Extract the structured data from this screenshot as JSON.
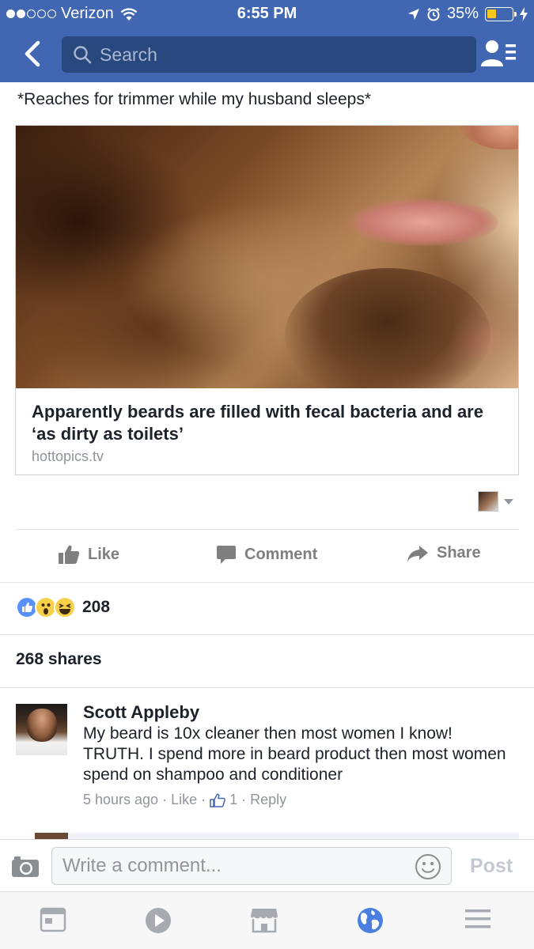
{
  "status_bar": {
    "carrier": "Verizon",
    "time": "6:55 PM",
    "battery": "35%",
    "battery_level": 0.35
  },
  "nav": {
    "search_placeholder": "Search",
    "back_icon": "chevron-left-icon",
    "friends_icon": "friend-requests-icon"
  },
  "post": {
    "caption": "*Reaches for trimmer while my husband sleeps*",
    "link": {
      "title": "Apparently beards are filled with fecal bacteria and are ‘as dirty as toilets’",
      "domain": "hottopics.tv"
    },
    "actions": {
      "like": "Like",
      "comment": "Comment",
      "share": "Share"
    },
    "reactions": {
      "types": [
        "like",
        "wow",
        "haha"
      ],
      "count": "208"
    },
    "shares": "268 shares"
  },
  "comment": {
    "author": "Scott Appleby",
    "text": "My beard is 10x cleaner then most women I know! TRUTH. I spend more in beard product then most women spend on shampoo and conditioner",
    "time": "5 hours ago",
    "like_label": "Like",
    "like_count": "1",
    "reply_label": "Reply"
  },
  "composer": {
    "placeholder": "Write a comment...",
    "post_label": "Post"
  },
  "tabbar": {
    "tabs": [
      "news-feed-icon",
      "video-icon",
      "marketplace-icon",
      "globe-icon",
      "menu-icon"
    ],
    "active": "globe-icon"
  },
  "colors": {
    "brand": "#4267b2",
    "search_bg": "#29487d",
    "action_gray": "#7f7f7f",
    "active_tab": "#4a7fe0"
  }
}
